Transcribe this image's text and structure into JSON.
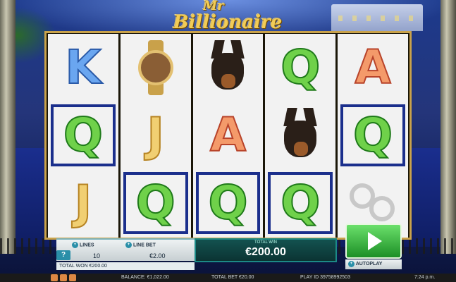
{
  "logo": {
    "line1": "Mr",
    "line2": "Billionaire"
  },
  "reels": [
    [
      "K",
      "Q",
      "J"
    ],
    [
      "watch",
      "J",
      "Q"
    ],
    [
      "dog",
      "A",
      "Q"
    ],
    [
      "Q",
      "dog",
      "Q"
    ],
    [
      "A",
      "Q",
      "handcuffs"
    ]
  ],
  "winning": [
    [
      0,
      1
    ],
    [
      1,
      2
    ],
    [
      2,
      2
    ],
    [
      3,
      2
    ],
    [
      4,
      1
    ]
  ],
  "controls": {
    "help": "?",
    "lines_label": "LINES",
    "lines_value": "10",
    "line_bet_label": "LINE BET",
    "line_bet_value": "€2.00",
    "total_win_label": "TOTAL WIN",
    "total_win_value": "€200.00",
    "total_won": "TOTAL WON €200.00",
    "autoplay_label": "AUTOPLAY"
  },
  "status": {
    "balance": "BALANCE: €1,022.00",
    "total_bet": "TOTAL BET €20.00",
    "play_id": "PLAY ID 39758992503",
    "time": "7:24 p.m."
  },
  "colors": {
    "win_border": "#1b2f8c",
    "spin": "#2aa836",
    "accent": "#2a8fa8"
  }
}
